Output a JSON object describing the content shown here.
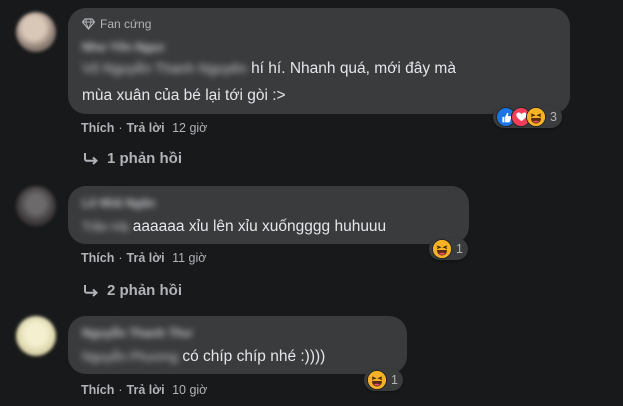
{
  "comments": [
    {
      "badge": "Fan cứng",
      "author": "Như Yến Ngọc",
      "text_line1": "hí hí. Nhanh quá, mới đây mà",
      "text_line2": "mùa xuân của bé lại tới gòi :>",
      "mention": "Võ Nguyễn Thanh Nguyên",
      "actions": {
        "like": "Thích",
        "reply": "Trả lời",
        "time": "12 giờ"
      },
      "reactions": {
        "icons": [
          "like-icon",
          "love-icon",
          "haha-icon"
        ],
        "count": "3"
      },
      "replies_label": "1 phản hồi"
    },
    {
      "author": "Lê Nhã Ngân",
      "mention": "Trần Hà",
      "text": "aaaaaa xỉu lên xỉu xuốngggg huhuuu",
      "actions": {
        "like": "Thích",
        "reply": "Trả lời",
        "time": "11 giờ"
      },
      "reactions": {
        "icons": [
          "haha-icon"
        ],
        "count": "1"
      },
      "replies_label": "2 phản hồi"
    },
    {
      "author": "Nguyễn Thanh Thư",
      "mention": "Nguyễn Phương",
      "text": "có chíp chíp nhé :))))",
      "actions": {
        "like": "Thích",
        "reply": "Trả lời",
        "time": "10 giờ"
      },
      "reactions": {
        "icons": [
          "haha-icon"
        ],
        "count": "1"
      }
    }
  ],
  "colors": {
    "background": "#18191a",
    "bubble": "#3a3b3c",
    "text": "#e4e6eb",
    "secondary": "#b0b3b8",
    "like": "#1b74e4",
    "love": "#f33e58",
    "haha": "#f7b125"
  }
}
